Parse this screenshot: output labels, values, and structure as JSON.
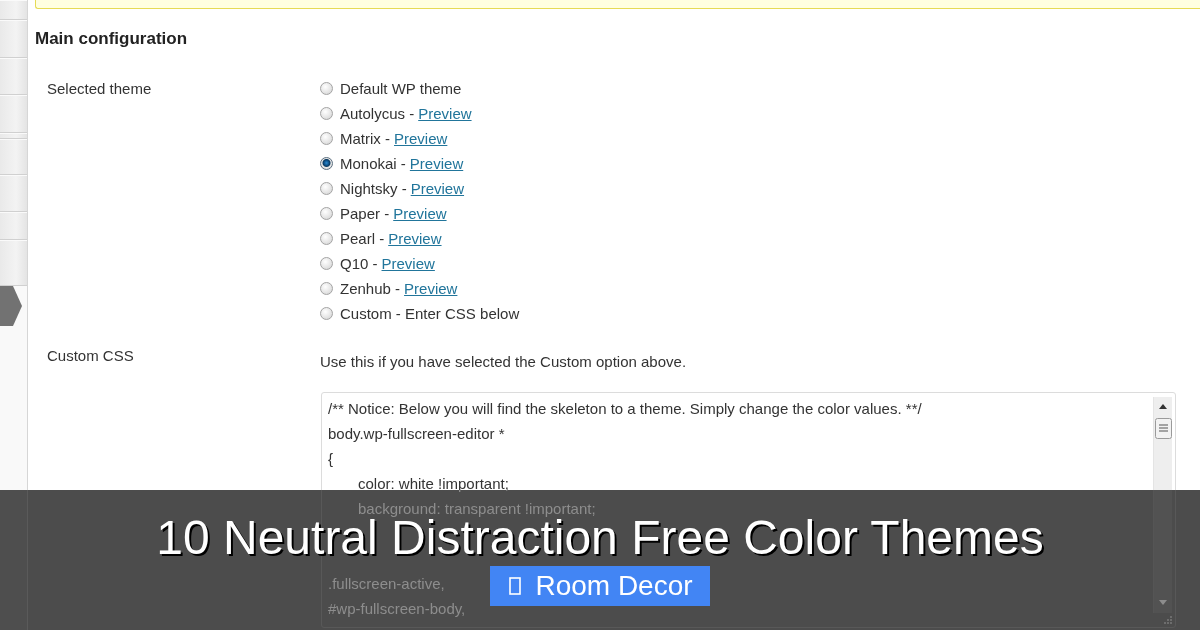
{
  "section_title": "Main configuration",
  "theme_setting": {
    "label": "Selected theme",
    "options": [
      {
        "label": "Default WP theme",
        "selected": false
      },
      {
        "label": "Autolycus -",
        "link": "Preview",
        "selected": false
      },
      {
        "label": "Matrix -",
        "link": "Preview",
        "selected": false
      },
      {
        "label": "Monokai -",
        "link": "Preview",
        "selected": true
      },
      {
        "label": "Nightsky -",
        "link": "Preview",
        "selected": false
      },
      {
        "label": "Paper -",
        "link": "Preview",
        "selected": false
      },
      {
        "label": "Pearl -",
        "link": "Preview",
        "selected": false
      },
      {
        "label": "Q10 -",
        "link": "Preview",
        "selected": false
      },
      {
        "label": "Zenhub -",
        "link": "Preview",
        "selected": false
      },
      {
        "label": "Custom - Enter CSS below",
        "selected": false
      }
    ]
  },
  "custom_css_setting": {
    "label": "Custom CSS",
    "description": "Use this if you have selected the Custom option above.",
    "editor": {
      "lines": [
        {
          "text": "/** Notice: Below you will find the skeleton to a theme. Simply change the color values. **/"
        },
        {
          "text": "body.wp-fullscreen-editor *"
        },
        {
          "text": "{",
          "children": [
            {
              "text": "color: white !important;"
            },
            {
              "text": "background: transparent !important;"
            }
          ]
        }
      ],
      "lines_below_title": [
        {
          "text": ".fullscreen-active,"
        },
        {
          "text": "#wp-fullscreen-body,"
        }
      ]
    }
  },
  "banner": {
    "title": "10 Neutral Distraction Free Color Themes",
    "button": "Room Decor"
  }
}
